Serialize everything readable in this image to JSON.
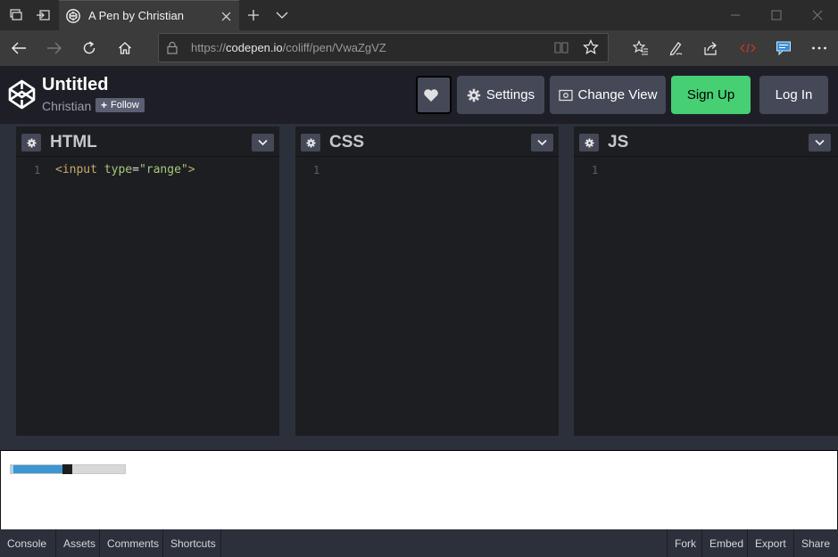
{
  "browser": {
    "tab_title": "A Pen by Christian",
    "url_prefix": "https://",
    "url_host": "codepen.io",
    "url_path": "/coliff/pen/VwaZgVZ"
  },
  "header": {
    "title": "Untitled",
    "author": "Christian",
    "follow_label": "Follow",
    "settings_label": "Settings",
    "change_view_label": "Change View",
    "signup_label": "Sign Up",
    "login_label": "Log In"
  },
  "editors": [
    {
      "name": "HTML",
      "line": "1"
    },
    {
      "name": "CSS",
      "line": "1"
    },
    {
      "name": "JS",
      "line": "1"
    }
  ],
  "html_code": {
    "open": "<input ",
    "attr": "type",
    "eq": "=",
    "value": "\"range\"",
    "close": ">"
  },
  "preview": {
    "range_value_percent": 50
  },
  "bottombar": {
    "left": [
      "Console",
      "Assets",
      "Comments",
      "Shortcuts"
    ],
    "right": [
      "Fork",
      "Embed",
      "Export",
      "Share"
    ]
  },
  "colors": {
    "signup": "#47cf73",
    "button": "#444857",
    "header_bg": "#1e1f26",
    "editor_bg": "#1d1e22"
  }
}
